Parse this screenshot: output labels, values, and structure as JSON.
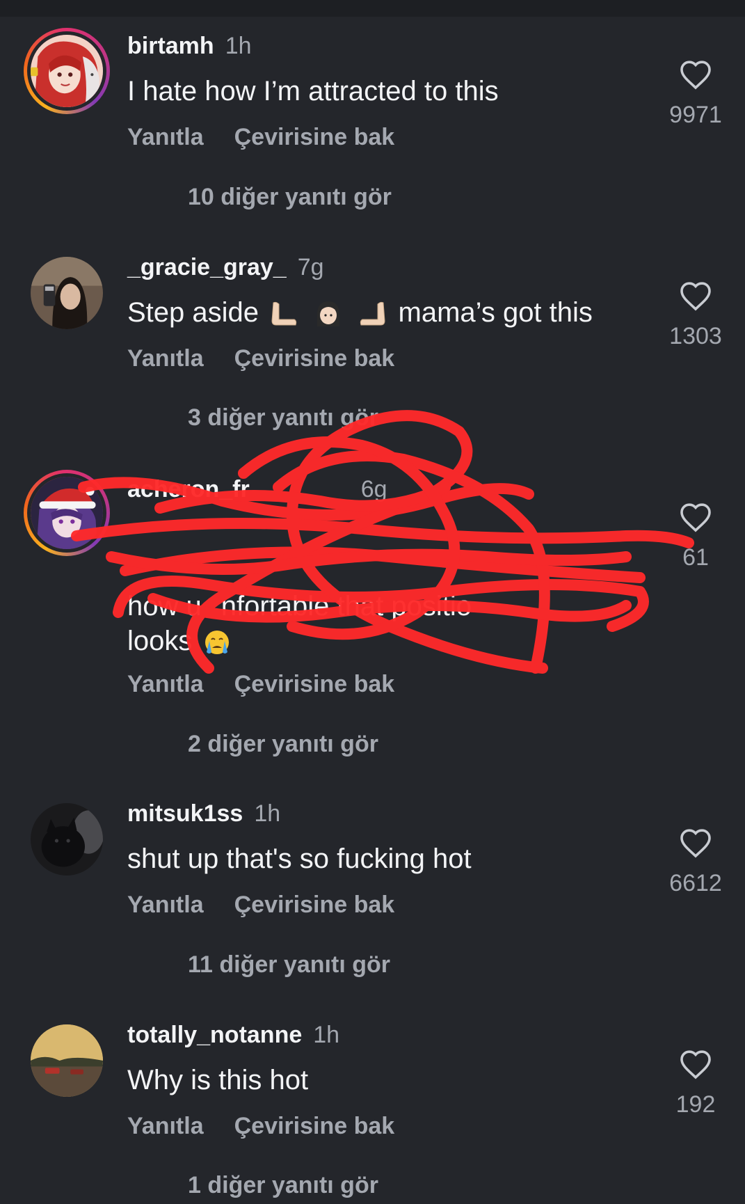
{
  "comments": [
    {
      "username": "birtamh",
      "time": "1h",
      "text": "I hate how I’m attracted to this",
      "reply_label": "Yanıtla",
      "translate_label": "Çevirisine bak",
      "more_replies": "10 diğer yanıtı gör",
      "likes": "9971",
      "avatar": "anime-red-hair-avatar",
      "story_ring": true
    },
    {
      "username": "_gracie_gray_",
      "time": "7g",
      "text_before": "Step aside",
      "text_after": "mama’s got this",
      "emojis": [
        "arm-left-emoji",
        "woman-face-emoji",
        "arm-right-emoji"
      ],
      "reply_label": "Yanıtla",
      "translate_label": "Çevirisine bak",
      "more_replies": "3 diğer yanıtı gör",
      "likes": "1303",
      "avatar": "selfie-photo-avatar",
      "story_ring": false
    },
    {
      "username": "acheron_fr",
      "time": "6g",
      "text_lines": [
        "how u",
        "nfortable that positio",
        "looks"
      ],
      "emoji": "crying-emoji",
      "reply_label": "Yanıtla",
      "translate_label": "Çevirisine bak",
      "more_replies": "2 diğer yanıtı gör",
      "likes": "61",
      "avatar": "anime-purple-hair-santa-hat-avatar",
      "story_ring": true,
      "scribbled_over": true,
      "scribble_color": "#ff2a2a"
    },
    {
      "username": "mitsuk1ss",
      "time": "1h",
      "text": "shut up that's so fucking hot",
      "reply_label": "Yanıtla",
      "translate_label": "Çevirisine bak",
      "more_replies": "11 diğer yanıtı gör",
      "likes": "6612",
      "avatar": "dark-cat-photo-avatar",
      "story_ring": false
    },
    {
      "username": "totally_notanne",
      "time": "1h",
      "text": "Why is this hot",
      "reply_label": "Yanıtla",
      "translate_label": "Çevirisine bak",
      "more_replies": "1 diğer yanıtı gör",
      "likes": "192",
      "avatar": "sunset-street-photo-avatar",
      "story_ring": false
    }
  ],
  "colors": {
    "background": "#24262b",
    "primary_text": "#f3f4f6",
    "secondary_text": "#a4a8b0",
    "scribble": "#ff2a2a"
  },
  "icons": {
    "like": "heart-outline-icon"
  }
}
